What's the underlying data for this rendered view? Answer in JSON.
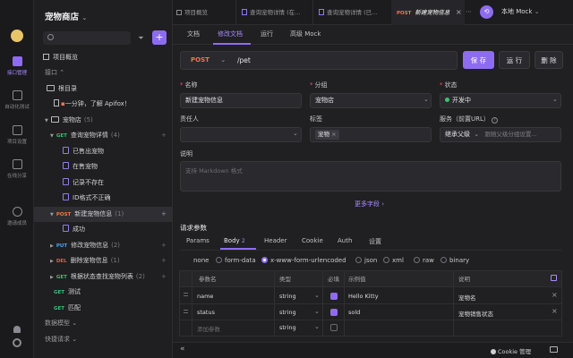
{
  "rail": {
    "items": [
      {
        "label": "接口管理"
      },
      {
        "label": "自动化测试"
      },
      {
        "label": "项目设置"
      },
      {
        "label": "在线分享"
      },
      {
        "label": "邀请成员"
      }
    ]
  },
  "sidebar": {
    "project_title": "宠物商店",
    "search_placeholder": "",
    "overview": "项目概览",
    "api_section": "接口",
    "root_dir": "根目录",
    "welcome_doc": "一分钟，了解 Apifox！",
    "tree": [
      {
        "label": "宠物店",
        "count": "(5)",
        "kind": "folder"
      },
      {
        "method": "GET",
        "label": "查询宠物详情",
        "count": "(4)"
      },
      {
        "label": "已售出宠物",
        "kind": "example"
      },
      {
        "label": "在售宠物",
        "kind": "example"
      },
      {
        "label": "记录不存在",
        "kind": "example"
      },
      {
        "label": "ID格式不正确",
        "kind": "example"
      },
      {
        "method": "POST",
        "label": "新建宠物信息",
        "count": "(1)"
      },
      {
        "label": "成功",
        "kind": "example"
      },
      {
        "method": "PUT",
        "label": "修改宠物信息",
        "count": "(2)"
      },
      {
        "method": "DEL",
        "label": "删除宠物信息",
        "count": "(1)"
      },
      {
        "method": "GET",
        "label": "根据状态查找宠物列表",
        "count": "(2)"
      },
      {
        "method": "GET",
        "label": "测试"
      },
      {
        "method": "GET",
        "label": "匹配"
      }
    ],
    "data_models": "数据模型",
    "quick_requests": "快捷请求"
  },
  "tabs": [
    {
      "label": "项目概览"
    },
    {
      "method": "GET",
      "label": "查询宠物详情 (在..."
    },
    {
      "label": "查询宠物详情 (已..."
    },
    {
      "method": "POST",
      "label": "新建宠物信息"
    }
  ],
  "env": {
    "label": "本地 Mock"
  },
  "subtabs": [
    "文档",
    "修改文档",
    "运行",
    "高级 Mock"
  ],
  "request": {
    "method": "POST",
    "path": "/pet",
    "save": "保 存",
    "run": "运 行",
    "delete": "删 除"
  },
  "form": {
    "name_label": "名称",
    "name_value": "新建宠物信息",
    "group_label": "分组",
    "group_value": "宠物店",
    "status_label": "状态",
    "status_value": "开发中",
    "owner_label": "责任人",
    "tags_label": "标签",
    "tag_value": "宠物",
    "service_label": "服务（前置URL）",
    "service_value": "继承父级",
    "service_placeholder": "跟随父级分组设置...",
    "desc_label": "说明",
    "desc_placeholder": "支持 Markdown 格式",
    "more_fields": "更多字段"
  },
  "params": {
    "title": "请求参数",
    "tabs": [
      "Params",
      "Body",
      "Header",
      "Cookie",
      "Auth",
      "设置"
    ],
    "body_count": "2",
    "body_types": [
      "none",
      "form-data",
      "x-www-form-urlencoded",
      "json",
      "xml",
      "raw",
      "binary"
    ],
    "headers": [
      "参数名",
      "类型",
      "必填",
      "示例值",
      "说明"
    ],
    "rows": [
      {
        "name": "name",
        "type": "string",
        "example": "Hello Kitty",
        "desc": "宠物名"
      },
      {
        "name": "status",
        "type": "string",
        "example": "sold",
        "desc": "宠物销售状态"
      }
    ],
    "add_placeholder": "添加参数",
    "add_type": "string"
  },
  "footer": {
    "cookie": "Cookie 管理"
  },
  "colors": {
    "accent": "#8e6cf0",
    "get": "#3fbf75",
    "post": "#f2754e",
    "put": "#4aa3f0",
    "del": "#f2545b"
  }
}
